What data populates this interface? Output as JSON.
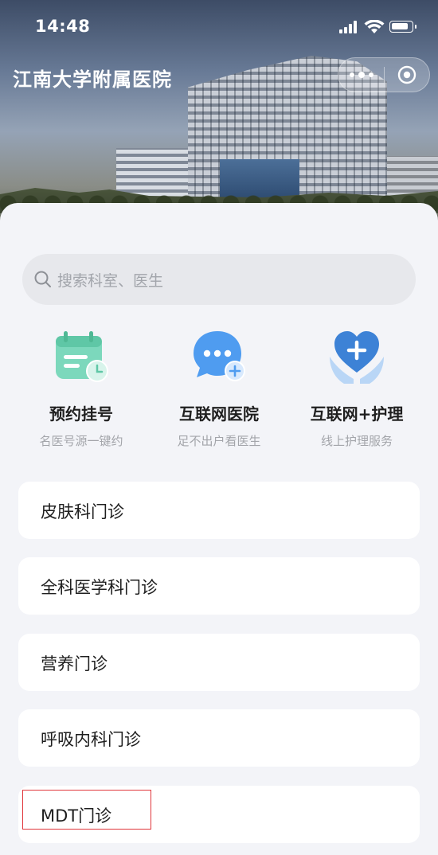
{
  "status_bar": {
    "time": "14:48"
  },
  "header": {
    "title": "江南大学附属医院"
  },
  "search": {
    "placeholder": "搜索科室、医生"
  },
  "services": [
    {
      "label": "预约挂号",
      "subtitle": "名医号源一键约",
      "icon": "calendar-icon"
    },
    {
      "label": "互联网医院",
      "subtitle": "足不出户看医生",
      "icon": "chat-bubble-icon"
    },
    {
      "label": "互联网+护理",
      "subtitle": "线上护理服务",
      "icon": "heart-hands-icon"
    }
  ],
  "clinics": [
    {
      "label": "皮肤科门诊"
    },
    {
      "label": "全科医学科门诊"
    },
    {
      "label": "营养门诊"
    },
    {
      "label": "呼吸内科门诊"
    },
    {
      "label": "MDT门诊"
    }
  ],
  "colors": {
    "highlight_border": "#e0353a",
    "background": "#f3f4f8"
  }
}
